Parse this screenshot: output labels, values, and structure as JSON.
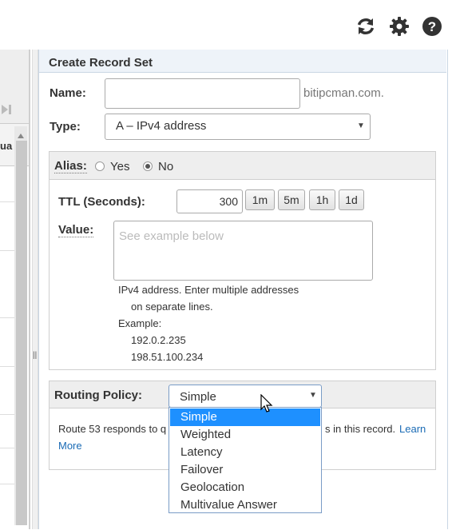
{
  "toolbar": {
    "refresh_icon": "refresh-icon",
    "settings_icon": "gear-icon",
    "help_icon": "help-icon"
  },
  "left": {
    "column_fragment": "ua"
  },
  "panel": {
    "title": "Create Record Set",
    "name_label": "Name:",
    "name_value": "",
    "name_suffix": "bitipcman.com.",
    "type_label": "Type:",
    "type_value": "A – IPv4 address",
    "alias_label": "Alias:",
    "alias_yes": "Yes",
    "alias_no": "No",
    "alias_selected": "No",
    "ttl_label": "TTL (Seconds):",
    "ttl_value": "300",
    "ttl_buttons": [
      "1m",
      "5m",
      "1h",
      "1d"
    ],
    "value_label": "Value:",
    "value_placeholder": "See example below",
    "help_line1": "IPv4 address. Enter multiple addresses",
    "help_line2": "on separate lines.",
    "help_example": "Example:",
    "help_ip1": "192.0.2.235",
    "help_ip2": "198.51.100.234",
    "routing_label": "Routing Policy:",
    "routing_value": "Simple",
    "routing_desc_start": "Route 53 responds to q",
    "routing_desc_end": "s in this record.",
    "learn_more_1": "Learn",
    "learn_more_2": "More"
  },
  "dropdown": {
    "options": [
      "Simple",
      "Weighted",
      "Latency",
      "Failover",
      "Geolocation",
      "Multivalue Answer"
    ],
    "selected": "Simple"
  },
  "colors": {
    "accent": "#1e90ff",
    "link": "#1a6bb5",
    "header_bg": "#eef3f9"
  }
}
